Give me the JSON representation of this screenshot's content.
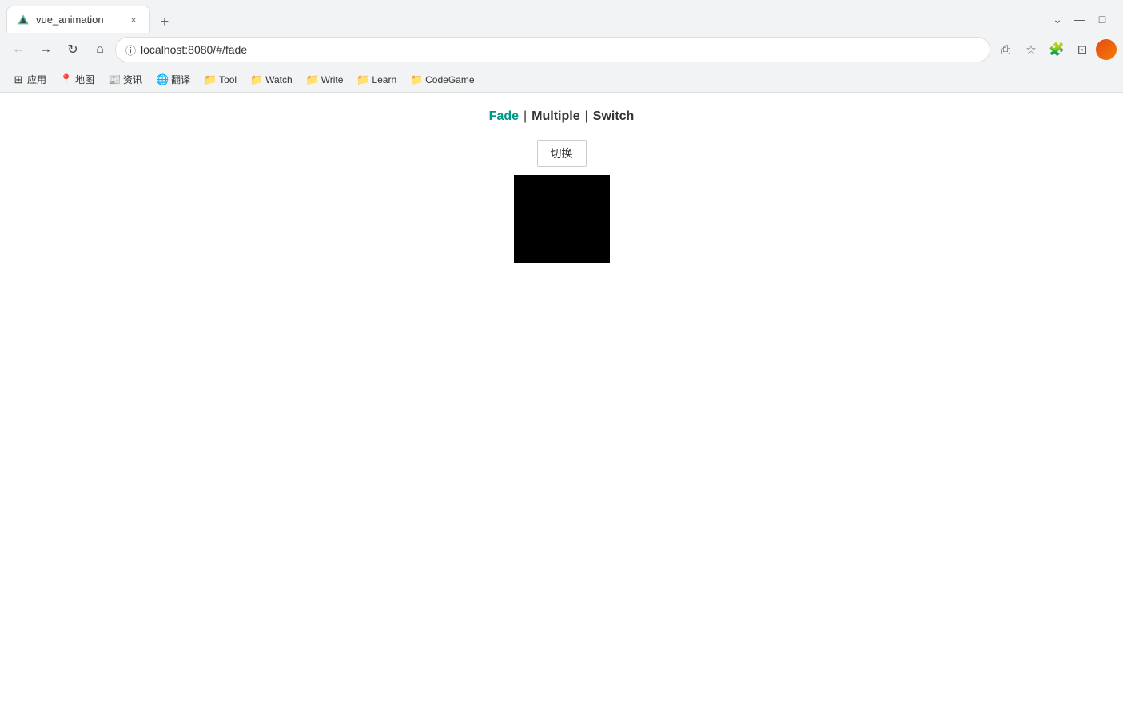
{
  "browser": {
    "tab": {
      "favicon_color": "#4CAF50",
      "title": "vue_animation",
      "close_label": "×"
    },
    "new_tab_label": "+",
    "window_controls": {
      "chevron_down": "⌄",
      "minimize": "—",
      "maximize": "□"
    },
    "nav": {
      "back_label": "←",
      "forward_label": "→",
      "reload_label": "↻",
      "home_label": "⌂",
      "url": "localhost:8080/#/fade",
      "share_label": "⎙",
      "star_label": "☆",
      "extensions_label": "🧩",
      "split_label": "⊡"
    },
    "bookmarks": [
      {
        "id": "apps",
        "icon": "grid",
        "label": "应用"
      },
      {
        "id": "maps",
        "icon": "map",
        "label": "地图"
      },
      {
        "id": "news",
        "icon": "news",
        "label": "资讯"
      },
      {
        "id": "translate",
        "icon": "translate",
        "label": "翻译"
      },
      {
        "id": "tool",
        "icon": "folder",
        "label": "Tool"
      },
      {
        "id": "watch",
        "icon": "folder",
        "label": "Watch"
      },
      {
        "id": "write",
        "icon": "folder",
        "label": "Write"
      },
      {
        "id": "learn",
        "icon": "folder",
        "label": "Learn"
      },
      {
        "id": "codegame",
        "icon": "folder",
        "label": "CodeGame"
      }
    ]
  },
  "page": {
    "nav_links": [
      {
        "id": "fade",
        "label": "Fade",
        "active": true
      },
      {
        "id": "multiple",
        "label": "Multiple",
        "active": false
      },
      {
        "id": "switch",
        "label": "Switch",
        "active": false
      }
    ],
    "separator": "|",
    "switch_button_label": "切换"
  }
}
